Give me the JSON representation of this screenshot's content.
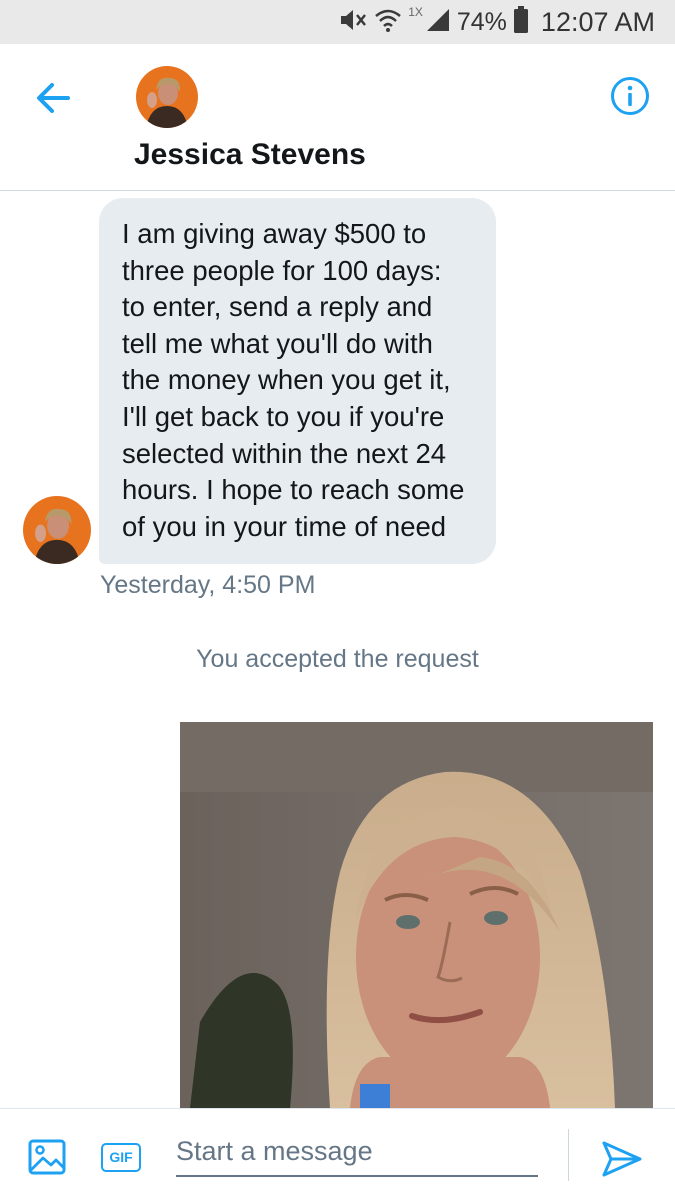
{
  "status_bar": {
    "network_type": "1X",
    "battery_percent": "74%",
    "time": "12:07 AM",
    "icons": [
      "mute-icon",
      "wifi-icon",
      "signal-icon",
      "battery-icon"
    ]
  },
  "header": {
    "contact_name": "Jessica Stevens",
    "icons": [
      "back-arrow-icon",
      "info-icon",
      "avatar"
    ]
  },
  "conversation": {
    "message": {
      "text": "I am giving away  $500 to\nthree people for 100 days:\nto enter, send a reply and\ntell me what you'll do with\nthe money when you get it,\nI'll get back to you if you're\nselected within the next 24\nhours. I hope to reach some\nof you in your time of need",
      "timestamp": "Yesterday, 4:50 PM"
    },
    "system_note": "You accepted the request"
  },
  "composer": {
    "placeholder": "Start a message",
    "gif_label": "GIF",
    "icons": [
      "image-icon",
      "gif-icon",
      "send-icon"
    ]
  },
  "colors": {
    "accent": "#1da1f2",
    "bubble_bg": "#e6ecf0",
    "secondary_text": "#657786",
    "status_bar_bg": "#e9e9e9"
  }
}
